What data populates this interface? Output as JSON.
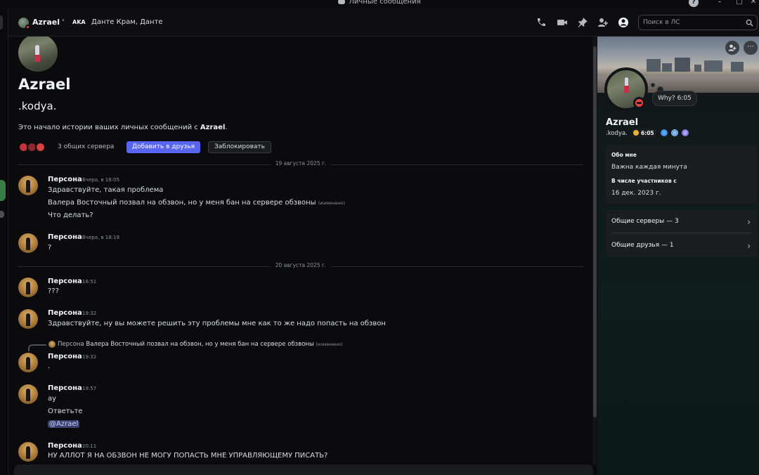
{
  "window": {
    "title": "Личные сообщения"
  },
  "header": {
    "name": "Azrael",
    "aka_label": "AKA",
    "aka_names": "Данте Крам, Данте",
    "search_placeholder": "Поиск в ЛС",
    "icons": [
      "phone-icon",
      "video-icon",
      "pin-icon",
      "add-friend-icon",
      "profile-toggle-icon",
      "search-icon"
    ]
  },
  "intro": {
    "display_name": "Azrael",
    "username": ".kodya.",
    "text_prefix": "Это начало истории ваших личных сообщений с ",
    "text_name": "Azrael",
    "text_suffix": ".",
    "mutual_servers": "3 общих сервера",
    "add_friend": "Добавить в друзья",
    "block": "Заблокировать"
  },
  "dividers": [
    "19 августа 2025 г.",
    "20 августа 2025 г."
  ],
  "messages": [
    {
      "author": "Персона",
      "time": "Вчера, в 18:05",
      "lines": [
        "Здравствуйте, такая проблема",
        "Валера Восточный позвал на обзвон, но у меня бан на сервере обзвоны",
        "Что делать?"
      ],
      "edited": "(изменено)"
    },
    {
      "author": "Персона",
      "time": "Вчера, в 18:19",
      "lines": [
        "?"
      ]
    },
    {
      "author": "Персона",
      "time": "16:51",
      "lines": [
        "???"
      ]
    },
    {
      "author": "Персона",
      "time": "19:32",
      "lines": [
        "Здравствуйте, ну вы можете решить эту проблемы мне как то же надо попасть на обзвон"
      ]
    },
    {
      "author": "Персона",
      "time": "19:32",
      "lines": [
        "."
      ],
      "reply": {
        "author": "Персона",
        "text": "Валера Восточный позвал на обзвон, но у меня бан на сервере обзвоны",
        "edited": "(изменено)"
      }
    },
    {
      "author": "Персона",
      "time": "19:57",
      "lines": [
        "ау",
        "Ответьте",
        "@Azrael"
      ]
    },
    {
      "author": "Персона",
      "time": "20:11",
      "lines": [
        "НУ АЛЛОТ Я НА ОБЗВОН НЕ МОГУ ПОПАСТЬ МНЕ УПРАВЛЯЮЩЕМУ ПИСАТЬ?"
      ]
    }
  ],
  "profile": {
    "display_name": "Azrael",
    "username": ".kodya.",
    "badge_time": "6:05",
    "status": "Why? 6:05",
    "about_label": "Обо мне",
    "about_text": "Важна каждая минута",
    "member_since_label": "В числе участников с",
    "member_since": "16 дек. 2023 г.",
    "mutual_servers": "Общие серверы — 3",
    "mutual_friends": "Общие друзья — 1",
    "colors": {
      "dnd": "#f23f43",
      "accent": "#5865f2"
    }
  }
}
